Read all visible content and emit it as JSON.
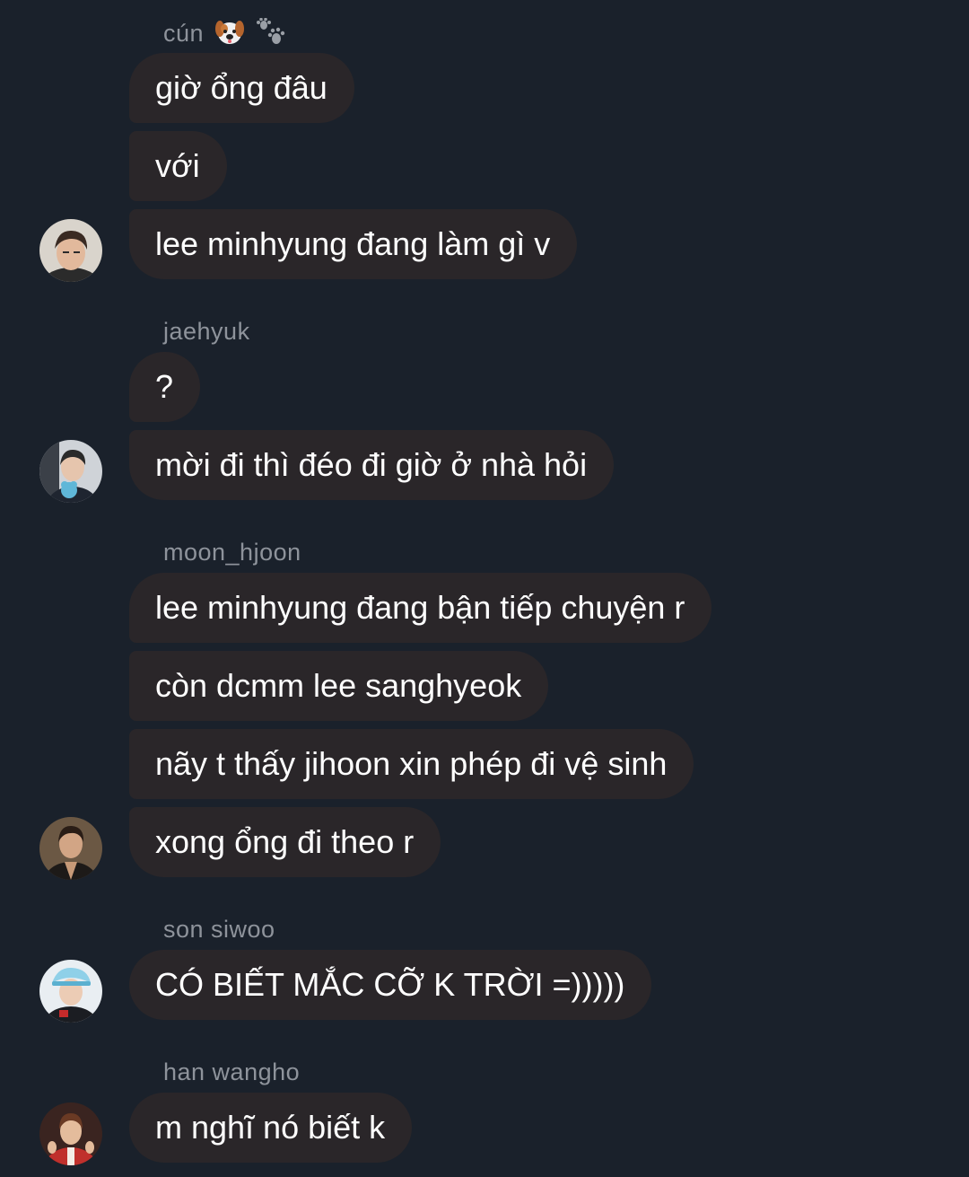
{
  "conversation": {
    "groups": [
      {
        "sender": "cún",
        "sender_emoji_icons": [
          "dog-face-icon",
          "paw-prints-icon"
        ],
        "messages": [
          "giờ ổng đâu",
          "với",
          "lee minhyung đang làm gì v"
        ]
      },
      {
        "sender": "jaehyuk",
        "messages": [
          "?",
          "mời đi thì đéo đi giờ ở nhà hỏi"
        ]
      },
      {
        "sender": "moon_hjoon",
        "messages": [
          "lee minhyung đang bận tiếp chuyện r",
          "còn dcmm lee sanghyeok",
          "nãy t thấy jihoon xin phép đi vệ sinh",
          "xong ổng đi theo r"
        ]
      },
      {
        "sender": "son siwoo",
        "messages": [
          "CÓ BIẾT MẮC CỠ K TRỜI =)))))"
        ]
      },
      {
        "sender": "han wangho",
        "messages": [
          "m nghĩ nó biết k"
        ]
      }
    ]
  },
  "colors": {
    "background": "#1a212b",
    "bubble": "#2a2629",
    "message_text": "#ffffff",
    "sender_text": "#8e939b"
  }
}
